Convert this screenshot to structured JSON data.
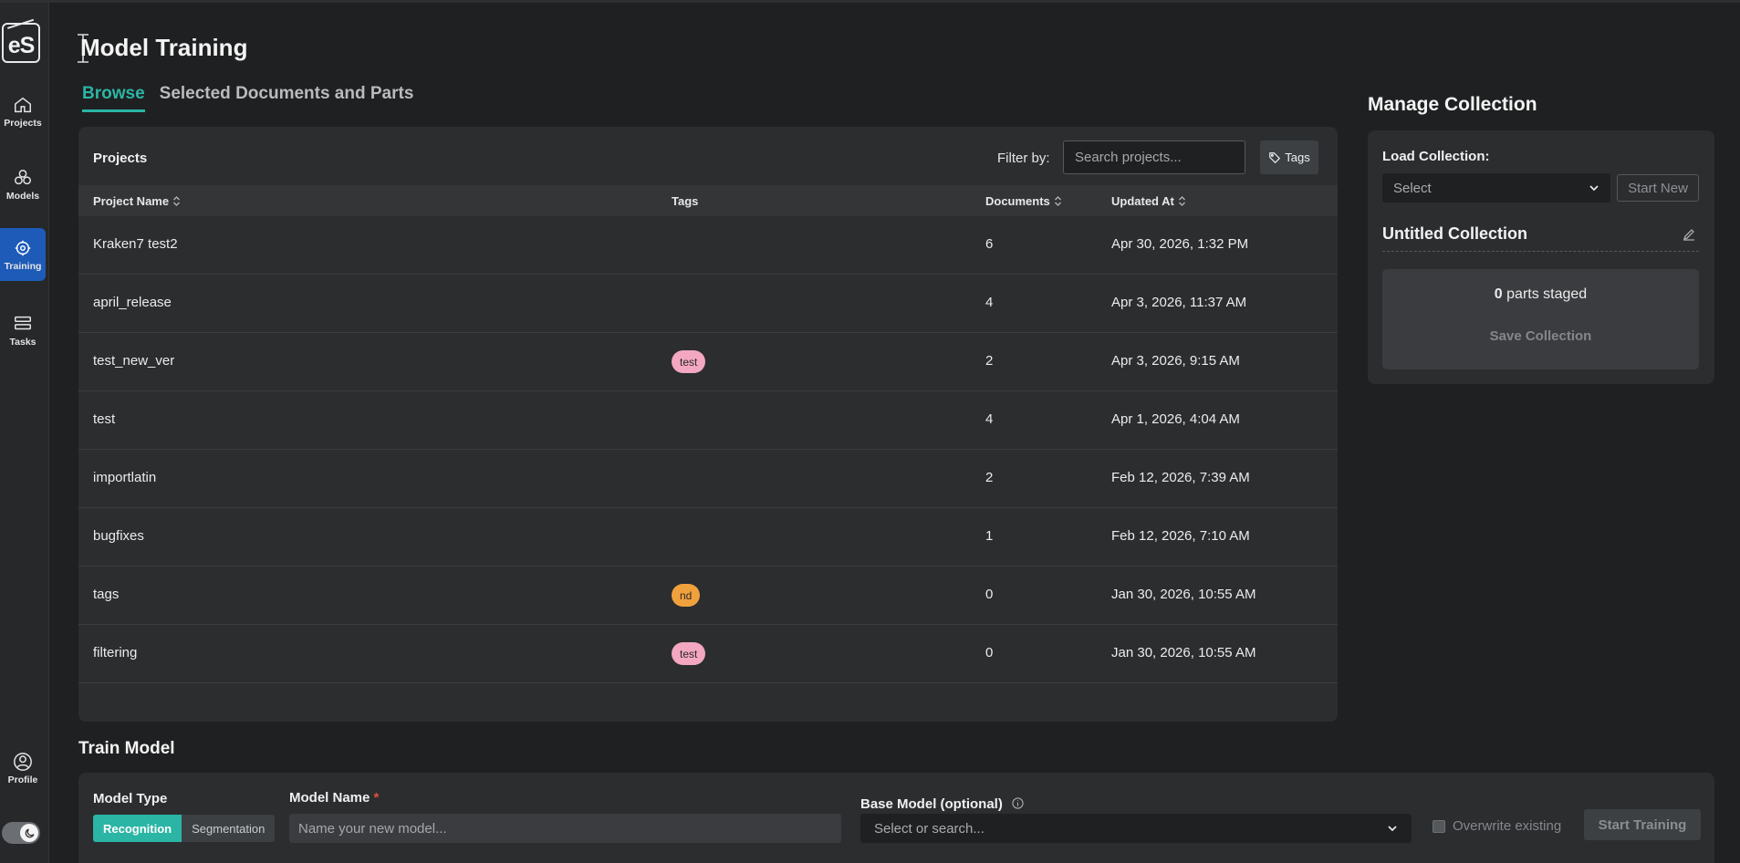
{
  "sidebar": {
    "logo": "eS",
    "items": [
      {
        "label": "Projects",
        "icon": "home-icon"
      },
      {
        "label": "Models",
        "icon": "models-icon"
      },
      {
        "label": "Training",
        "icon": "training-icon"
      },
      {
        "label": "Tasks",
        "icon": "tasks-icon"
      }
    ],
    "profile_label": "Profile"
  },
  "header": {
    "title": "Model Training",
    "tabs": [
      {
        "label": "Browse",
        "active": true
      },
      {
        "label": "Selected Documents and Parts",
        "active": false
      }
    ]
  },
  "projects": {
    "title": "Projects",
    "filter_label": "Filter by:",
    "search_placeholder": "Search projects...",
    "tags_button": "Tags",
    "columns": [
      "Project Name",
      "Tags",
      "Documents",
      "Updated At"
    ],
    "rows": [
      {
        "name": "Kraken7 test2",
        "tag": "",
        "documents": "6",
        "updated": "Apr 30, 2026, 1:32 PM"
      },
      {
        "name": "april_release",
        "tag": "",
        "documents": "4",
        "updated": "Apr 3, 2026, 11:37 AM"
      },
      {
        "name": "test_new_ver",
        "tag": "test",
        "tag_color": "#f3a7c0",
        "documents": "2",
        "updated": "Apr 3, 2026, 9:15 AM"
      },
      {
        "name": "test",
        "tag": "",
        "documents": "4",
        "updated": "Apr 1, 2026, 4:04 AM"
      },
      {
        "name": "importlatin",
        "tag": "",
        "documents": "2",
        "updated": "Feb 12, 2026, 7:39 AM"
      },
      {
        "name": "bugfixes",
        "tag": "",
        "documents": "1",
        "updated": "Feb 12, 2026, 7:10 AM"
      },
      {
        "name": "tags",
        "tag": "nd",
        "tag_color": "#f0a13c",
        "documents": "0",
        "updated": "Jan 30, 2026, 10:55 AM"
      },
      {
        "name": "filtering",
        "tag": "test",
        "tag_color": "#f3a7c0",
        "documents": "0",
        "updated": "Jan 30, 2026, 10:55 AM"
      }
    ]
  },
  "collection": {
    "title": "Manage Collection",
    "load_label": "Load Collection:",
    "select_value": "Select",
    "start_new": "Start New",
    "name": "Untitled Collection",
    "staged_count": "0",
    "staged_text": " parts staged",
    "save_button": "Save Collection"
  },
  "train": {
    "title": "Train Model",
    "model_type_label": "Model Type",
    "types": [
      "Recognition",
      "Segmentation"
    ],
    "model_name_label": "Model Name",
    "required_mark": "*",
    "model_name_placeholder": "Name your new model...",
    "base_model_label": "Base Model (optional)",
    "base_model_placeholder": "Select or search...",
    "overwrite_label": "Overwrite existing",
    "start_button": "Start Training"
  },
  "colors": {
    "accent": "#2bb5a5",
    "active_nav": "#1e5bb8",
    "required": "#e0503f"
  }
}
